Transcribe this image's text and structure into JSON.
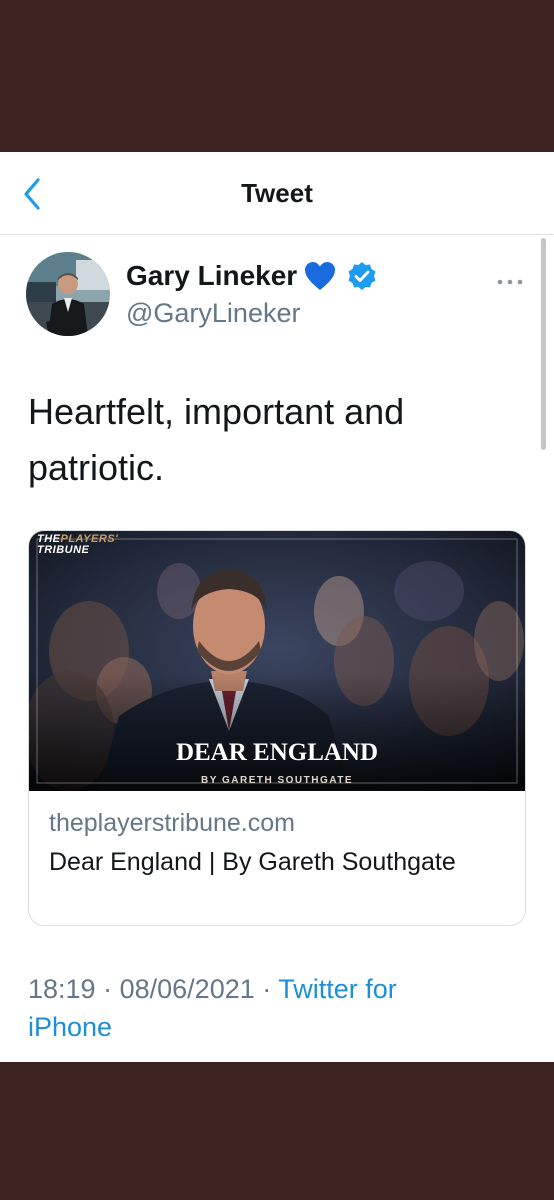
{
  "nav": {
    "title": "Tweet",
    "back_icon": "chevron-left-icon"
  },
  "colors": {
    "accent": "#1d9bf0",
    "background_band": "#3d2420",
    "secondary_text": "#657786"
  },
  "tweet": {
    "author_name": "Gary Lineker",
    "author_emoji": "blue-heart-icon",
    "verified_icon": "verified-badge-icon",
    "handle": "@GaryLineker",
    "more_icon": "ellipsis-icon",
    "text": "Heartfelt, important and patriotic.",
    "card": {
      "image_brand_line1": "THE",
      "image_brand_line1b": "PLAYERS'",
      "image_brand_line2": "TRIBUNE",
      "image_headline": "DEAR ENGLAND",
      "image_byline": "BY GARETH SOUTHGATE",
      "domain": "theplayerstribune.com",
      "title": "Dear England | By Gareth Southgate"
    },
    "time": "18:19",
    "separator": "·",
    "date": "08/06/2021",
    "source": "Twitter for iPhone"
  }
}
